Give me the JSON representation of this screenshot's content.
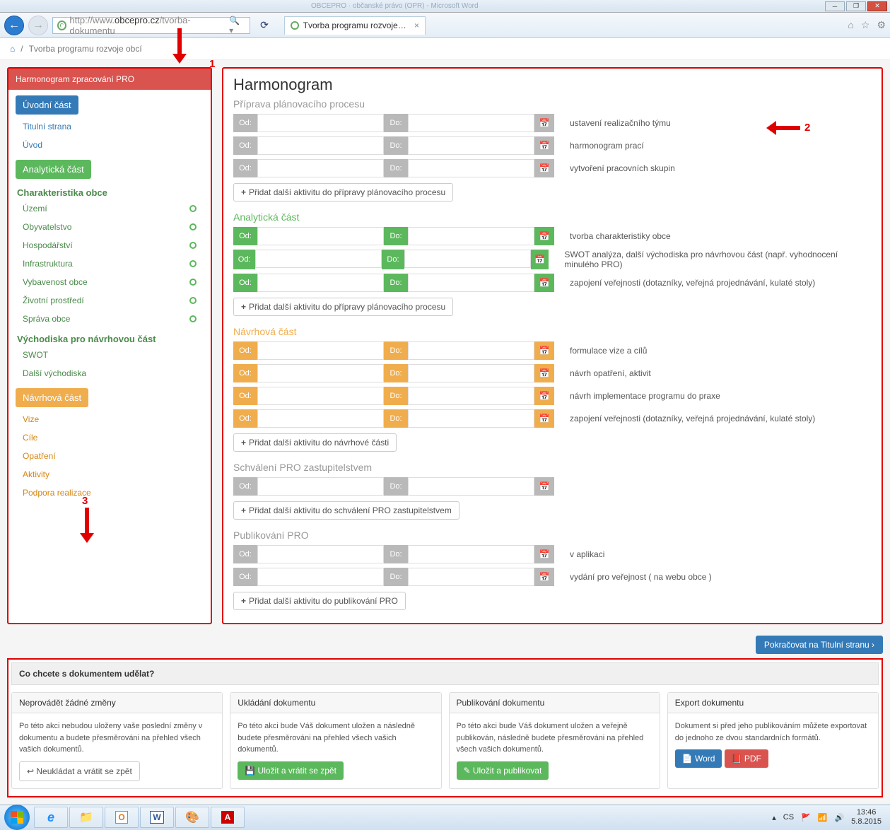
{
  "browser": {
    "url_gray_prefix": "http://www.",
    "url_host": "obcepro.cz",
    "url_path": "/tvorba-dokumentu",
    "search_hint": "🔍 ▾",
    "tab_title": "Tvorba programu rozvoje o...",
    "title_bar_faint": "OBCEPRO · občanské právo (OPR) - Microsoft Word"
  },
  "breadcrumb": {
    "home": "⌂",
    "sep": "/",
    "text": "Tvorba programu rozvoje obcí"
  },
  "sidebar": {
    "header": "Harmonogram zpracování PRO",
    "intro_badge": "Úvodní část",
    "intro_links": [
      "Titulní strana",
      "Úvod"
    ],
    "analytic_badge": "Analytická část",
    "char_header": "Charakteristika obce",
    "char_items": [
      "Území",
      "Obyvatelstvo",
      "Hospodářství",
      "Infrastruktura",
      "Vybavenost obce",
      "Životní prostředí",
      "Správa obce"
    ],
    "vychodiska_header": "Východiska pro návrhovou část",
    "vychodiska_items": [
      "SWOT",
      "Další východiska"
    ],
    "navrh_badge": "Návrhová část",
    "navrh_items": [
      "Vize",
      "Cíle",
      "Opatření",
      "Aktivity",
      "Podpora realizace"
    ]
  },
  "main": {
    "title": "Harmonogram",
    "od": "Od:",
    "do": "Do:",
    "sections": [
      {
        "title": "Příprava plánovacího procesu",
        "color": "gray",
        "rows": [
          "ustavení realizačního týmu",
          "harmonogram prací",
          "vytvoření pracovních skupin"
        ],
        "add": "Přidat další aktivitu do přípravy plánovacího procesu"
      },
      {
        "title": "Analytická část",
        "color": "green",
        "rows": [
          "tvorba charakteristiky obce",
          "SWOT analýza, další východiska pro návrhovou část (např. vyhodnocení minulého PRO)",
          "zapojení veřejnosti (dotazníky, veřejná projednávání, kulaté stoly)"
        ],
        "add": "Přidat další aktivitu do přípravy plánovacího procesu"
      },
      {
        "title": "Návrhová část",
        "color": "orange",
        "rows": [
          "formulace vize a cílů",
          "návrh opatření, aktivit",
          "návrh implementace programu do praxe",
          "zapojení veřejnosti (dotazníky, veřejná projednávání, kulaté stoly)"
        ],
        "add": "Přidat další aktivitu do návrhové části"
      },
      {
        "title": "Schválení PRO zastupitelstvem",
        "color": "gray",
        "rows": [
          ""
        ],
        "add": "Přidat další aktivitu do schválení PRO zastupitelstvem"
      },
      {
        "title": "Publikování PRO",
        "color": "gray",
        "rows": [
          "v aplikaci",
          "vydání pro veřejnost ( na webu obce )"
        ],
        "add": "Přidat další aktivitu do publikování PRO"
      }
    ],
    "continue": "Pokračovat na Titulní stranu ›"
  },
  "bottom": {
    "header": "Co chcete s dokumentem udělat?",
    "cards": [
      {
        "title": "Neprovádět žádné změny",
        "text": "Po této akci nebudou uloženy vaše poslední změny v dokumentu a budete přesměrováni na přehled všech vašich dokumentů.",
        "btn": "↩ Neukládat a vrátit se zpět",
        "btn_class": "default"
      },
      {
        "title": "Ukládání dokumentu",
        "text": "Po této akci bude Váš dokument uložen a následně budete přesměrováni na přehled všech vašich dokumentů.",
        "btn": "💾 Uložit a vrátit se zpět",
        "btn_class": "success"
      },
      {
        "title": "Publikování dokumentu",
        "text": "Po této akci bude Váš dokument uložen a veřejně publikován, následně budete přesměrováni na přehled všech vašich dokumentů.",
        "btn": "✎ Uložit a publikovat",
        "btn_class": "success"
      },
      {
        "title": "Export dokumentu",
        "text": "Dokument si před jeho publikováním můžete exportovat do jednoho ze dvou standardních formátů.",
        "btn_word": "📄 Word",
        "btn_pdf": "📕 PDF"
      }
    ]
  },
  "taskbar": {
    "lang": "CS",
    "time": "13:46",
    "date": "5.8.2015"
  },
  "annotations": {
    "a1": "1",
    "a2": "2",
    "a3": "3"
  }
}
